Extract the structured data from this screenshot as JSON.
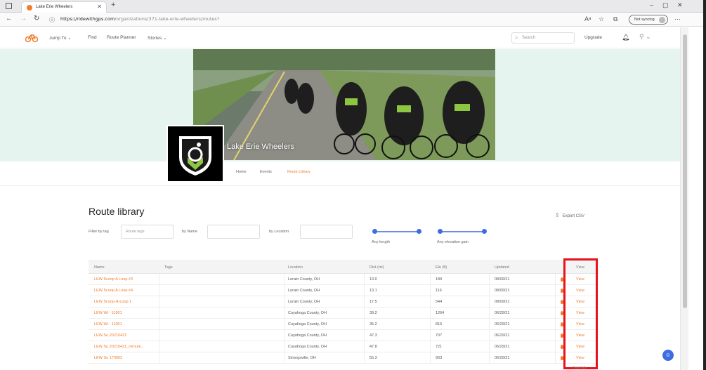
{
  "browser": {
    "tab_title": "Lake Erie Wheelers",
    "new_tab": "+",
    "url_host": "https://ridewithgps.com",
    "url_path": "/organizations/371-lake-erie-wheelers/routes?",
    "not_syncing": "Not syncing",
    "window_controls": [
      "–",
      "▢",
      "✕"
    ]
  },
  "site_nav": {
    "links": [
      "Jump To",
      "Find",
      "Route Planner",
      "Stories"
    ],
    "search_placeholder": "Search",
    "upgrade": "Upgrade"
  },
  "org": {
    "name": "Lake Erie Wheelers",
    "tabs": [
      "Home",
      "Events",
      "Route Library"
    ],
    "active_tab": "Route Library"
  },
  "library": {
    "title": "Route library",
    "export_label": "Export CSV",
    "filters": {
      "tag_label": "Filter by tag",
      "tag_placeholder": "Route tags",
      "name_label": "by Name",
      "location_label": "by Location",
      "length_label": "Any length",
      "elevation_label": "Any elevation gain"
    },
    "columns": [
      "Name",
      "Tags",
      "Location",
      "Dist (mi)",
      "Ele (ft)",
      "Updated",
      "View"
    ],
    "rows": [
      {
        "name": "LEW Scoop A Loop #3",
        "tags": "",
        "location": "Lorain County, OH",
        "dist": "13.0",
        "ele": "189",
        "updated": "08/09/21",
        "view": "View"
      },
      {
        "name": "LEW Scoop A Loop #4",
        "tags": "",
        "location": "Lorain County, OH",
        "dist": "13.1",
        "ele": "116",
        "updated": "08/09/21",
        "view": "View"
      },
      {
        "name": "LEW Scoop-A-Loop 1",
        "tags": "",
        "location": "Lorain County, OH",
        "dist": "17.5",
        "ele": "544",
        "updated": "08/09/21",
        "view": "View"
      },
      {
        "name": "LEW Wi - 11001",
        "tags": "",
        "location": "Cuyahoga County, OH",
        "dist": "39.2",
        "ele": "1264",
        "updated": "06/29/21",
        "view": "View"
      },
      {
        "name": "LEW Wi - 11001",
        "tags": "",
        "location": "Cuyahoga County, OH",
        "dist": "35.2",
        "ele": "816",
        "updated": "06/29/21",
        "view": "View"
      },
      {
        "name": "LEW Su 20210421",
        "tags": "",
        "location": "Cuyahoga County, OH",
        "dist": "47.3",
        "ele": "707",
        "updated": "06/29/21",
        "view": "View"
      },
      {
        "name": "LEW Su 20210421_reroute...",
        "tags": "",
        "location": "Cuyahoga County, OH",
        "dist": "47.8",
        "ele": "721",
        "updated": "06/29/21",
        "view": "View"
      },
      {
        "name": "LEW Su 170903",
        "tags": "",
        "location": "Strongsville, OH",
        "dist": "55.3",
        "ele": "903",
        "updated": "06/29/21",
        "view": "View"
      }
    ],
    "footer_note": "Heat lab"
  },
  "colors": {
    "accent": "#f07a2b",
    "highlight": "#e8121c",
    "slider": "#3d6de0",
    "hero_bg": "#e6f4ef"
  }
}
